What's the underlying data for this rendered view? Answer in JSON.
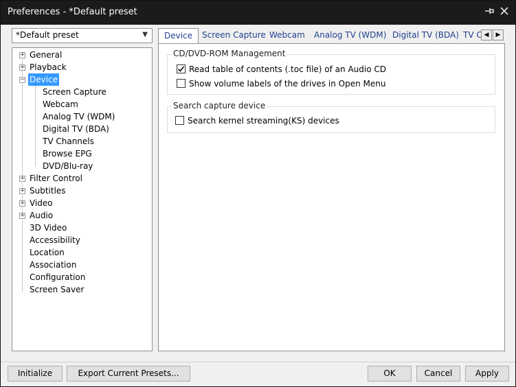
{
  "window": {
    "title": "Preferences - *Default preset"
  },
  "titlebar": {
    "pin_icon": "pin-icon",
    "close_icon": "close-icon"
  },
  "preset_select": {
    "value": "*Default preset"
  },
  "tree": {
    "items": [
      {
        "label": "General",
        "expandable": true
      },
      {
        "label": "Playback",
        "expandable": true
      },
      {
        "label": "Device",
        "expandable": true,
        "expanded": true,
        "selected": true
      },
      {
        "label": "Screen Capture",
        "child": true
      },
      {
        "label": "Webcam",
        "child": true
      },
      {
        "label": "Analog TV (WDM)",
        "child": true
      },
      {
        "label": "Digital TV (BDA)",
        "child": true
      },
      {
        "label": "TV Channels",
        "child": true
      },
      {
        "label": "Browse EPG",
        "child": true
      },
      {
        "label": "DVD/Blu-ray",
        "child": true
      },
      {
        "label": "Filter Control",
        "expandable": true
      },
      {
        "label": "Subtitles",
        "expandable": true
      },
      {
        "label": "Video",
        "expandable": true
      },
      {
        "label": "Audio",
        "expandable": true
      },
      {
        "label": "3D Video"
      },
      {
        "label": "Accessibility"
      },
      {
        "label": "Location"
      },
      {
        "label": "Association"
      },
      {
        "label": "Configuration"
      },
      {
        "label": "Screen Saver"
      }
    ]
  },
  "tabs": [
    {
      "label": "Device",
      "active": true
    },
    {
      "label": "Screen Capture"
    },
    {
      "label": "Webcam"
    },
    {
      "label": "Analog TV (WDM)"
    },
    {
      "label": "Digital TV (BDA)"
    },
    {
      "label": "TV C"
    }
  ],
  "panel": {
    "cd_group": {
      "title": "CD/DVD-ROM Management",
      "options": [
        {
          "label": "Read table of contents (.toc file) of an Audio CD",
          "checked": true
        },
        {
          "label": "Show volume labels of the drives in Open Menu",
          "checked": false
        }
      ]
    },
    "capture_group": {
      "title": "Search capture device",
      "options": [
        {
          "label": "Search kernel streaming(KS) devices",
          "checked": false
        }
      ]
    }
  },
  "buttons": {
    "initialize": "Initialize",
    "export": "Export Current Presets...",
    "ok": "OK",
    "cancel": "Cancel",
    "apply": "Apply"
  },
  "colors": {
    "titlebar": "#1b1b1b",
    "selection": "#3399ff",
    "tab_text": "#1f3f8f"
  }
}
